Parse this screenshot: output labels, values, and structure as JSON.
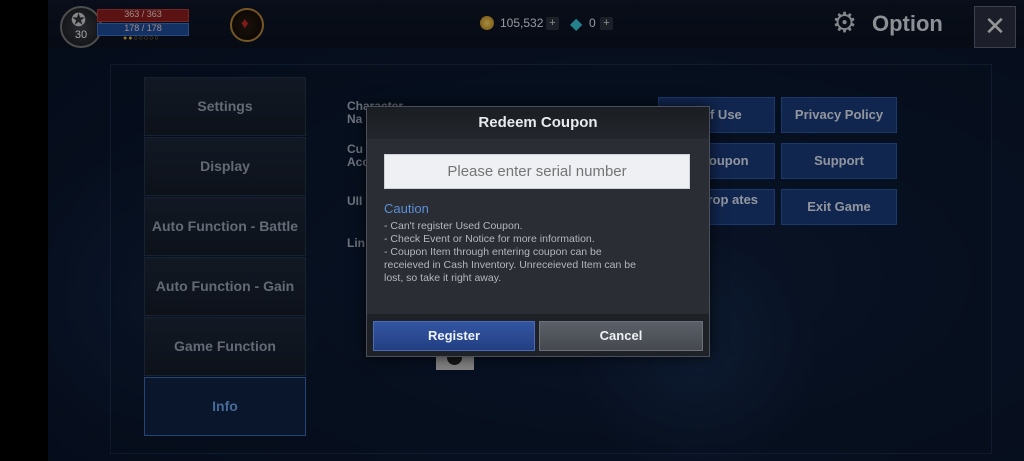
{
  "player": {
    "level": "30",
    "hp": "363 / 363",
    "mp": "178 / 178"
  },
  "currency": {
    "gold": "105,532",
    "gems": "0"
  },
  "header": {
    "title": "Option"
  },
  "sidebar": {
    "items": [
      {
        "label": "Settings"
      },
      {
        "label": "Display"
      },
      {
        "label": "Auto Function - Battle"
      },
      {
        "label": "Auto Function - Gain"
      },
      {
        "label": "Game Function"
      },
      {
        "label": "Info"
      }
    ]
  },
  "info": {
    "labels": [
      "Character Na",
      "Cu Acc",
      "UII",
      "Lin"
    ],
    "buttons": [
      "s of Use",
      "Privacy Policy",
      "m Coupon",
      "Support",
      "um Drop ates",
      "Exit Game"
    ]
  },
  "modal": {
    "title": "Redeem Coupon",
    "placeholder": "Please enter serial number",
    "caution_title": "Caution",
    "notes": [
      "- Can't register Used Coupon.",
      "- Check Event or Notice for more information.",
      "- Coupon Item through entering coupon can be",
      "receieved in Cash Inventory. Unreceieved Item can be",
      "lost, so take it right away."
    ],
    "register_label": "Register",
    "cancel_label": "Cancel"
  }
}
